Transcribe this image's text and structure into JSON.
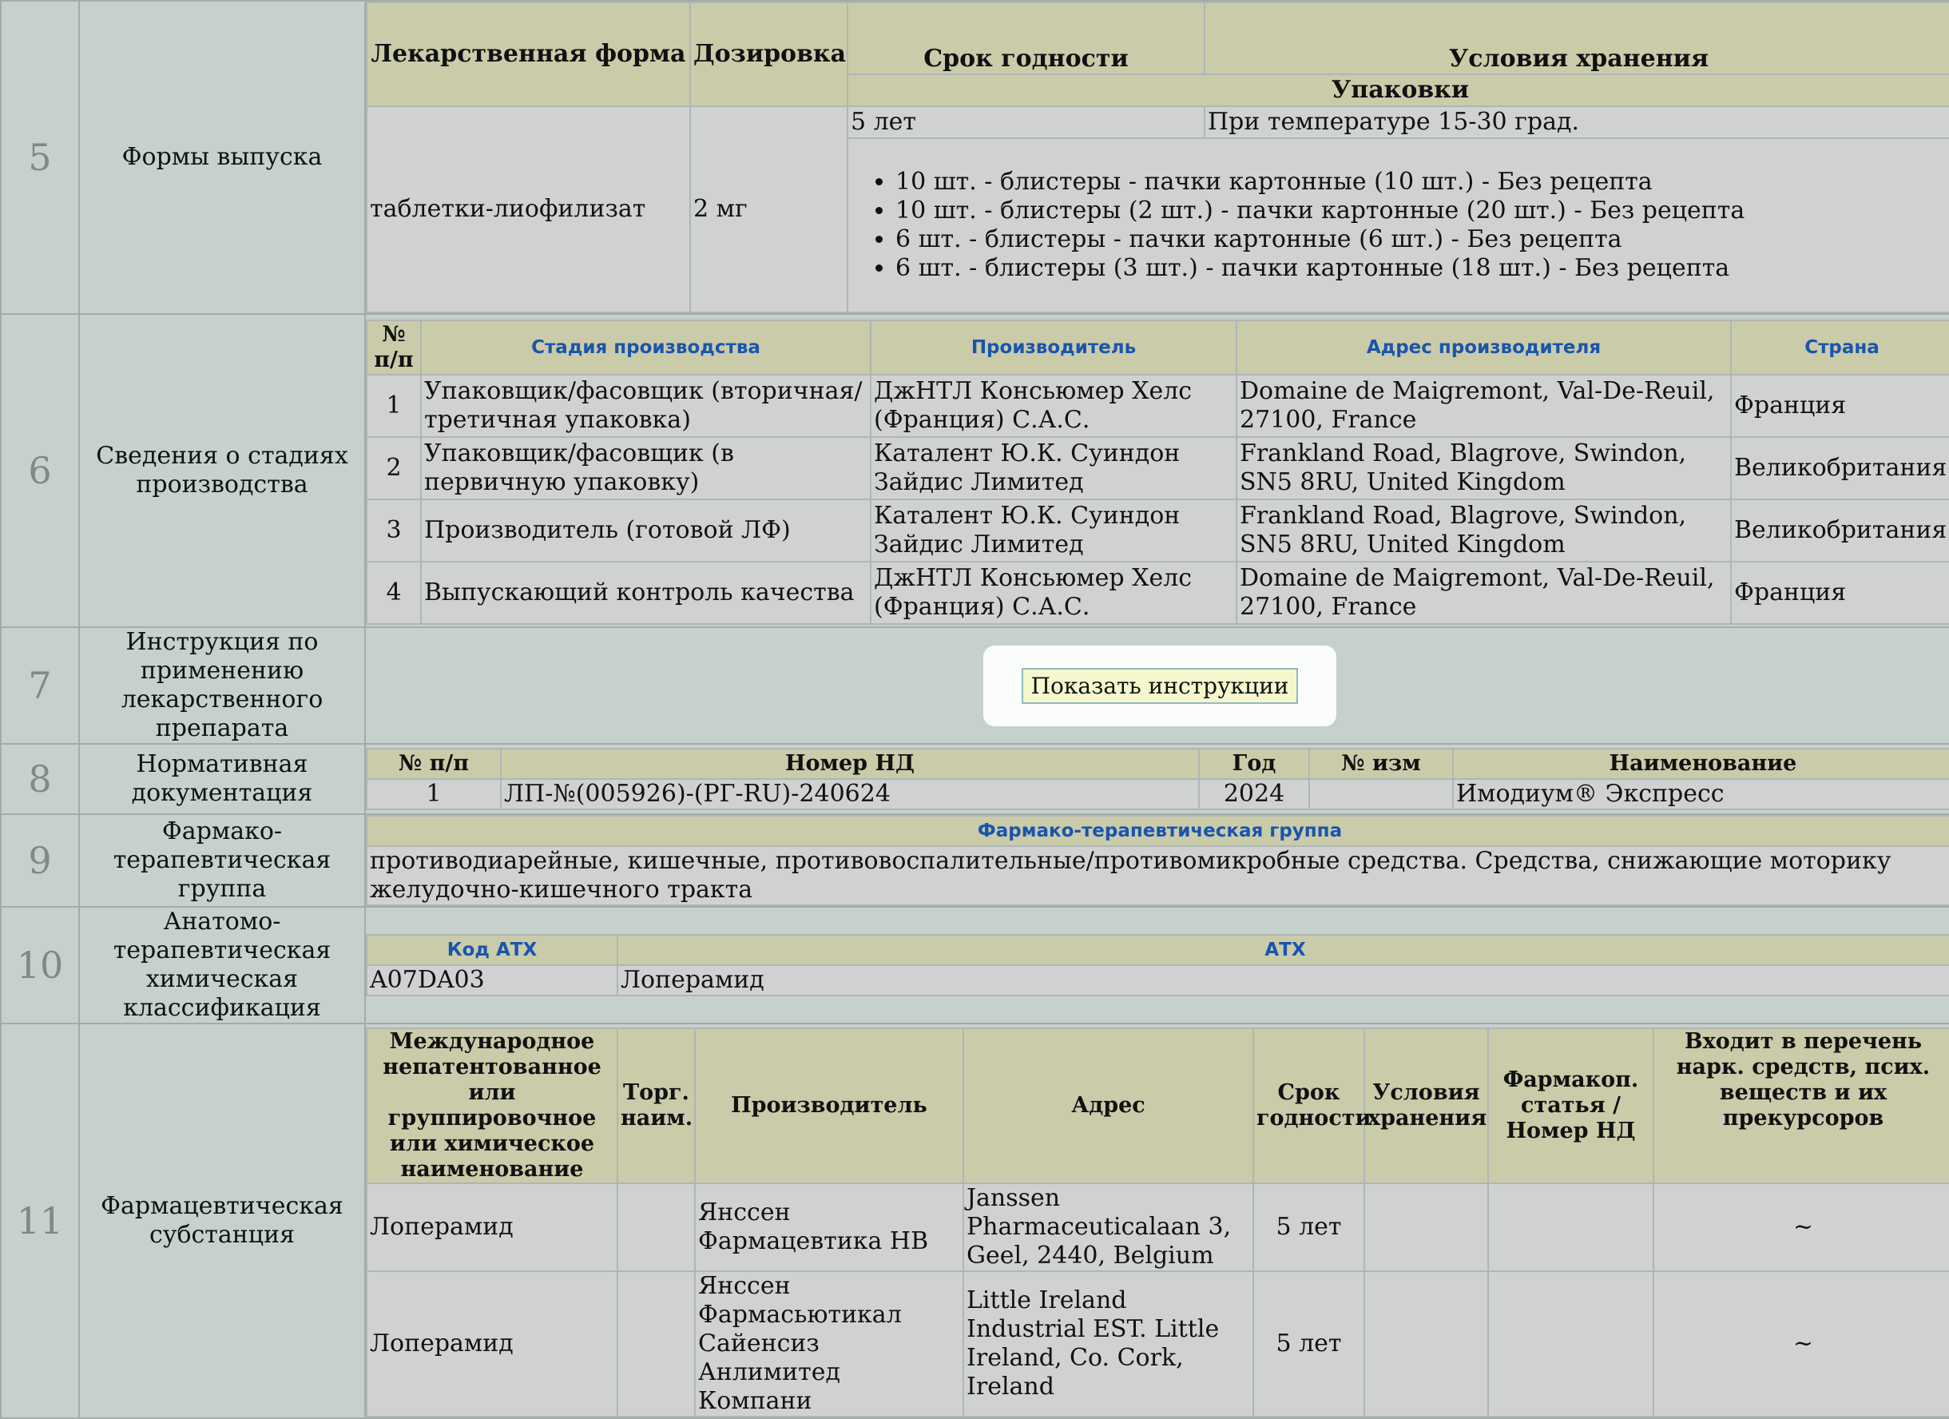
{
  "rows": {
    "r5": {
      "num": "5",
      "label": "Формы выпуска"
    },
    "r6": {
      "num": "6",
      "label": "Сведения о стадиях производства"
    },
    "r7": {
      "num": "7",
      "label": "Инструкция по применению лекарственного препарата"
    },
    "r8": {
      "num": "8",
      "label": "Нормативная документация"
    },
    "r9": {
      "num": "9",
      "label": "Фармако-терапевтическая группа"
    },
    "r10": {
      "num": "10",
      "label": "Анатомо-терапевтическая химическая классификация"
    },
    "r11": {
      "num": "11",
      "label": "Фармацевтическая субстанция"
    }
  },
  "forms": {
    "headers": {
      "form": "Лекарственная форма",
      "dosage": "Дозировка",
      "shelf": "Срок годности",
      "storage": "Условия хранения",
      "packages": "Упаковки"
    },
    "form": "таблетки-лиофилизат",
    "dosage": "2 мг",
    "shelf": "5 лет",
    "storage": "При температуре 15-30 град.",
    "packs": [
      "10 шт. - блистеры - пачки картонные (10 шт.) - Без рецепта",
      "10 шт. - блистеры (2 шт.) - пачки картонные (20 шт.) - Без рецепта",
      "6 шт. - блистеры - пачки картонные (6 шт.) - Без рецепта",
      "6 шт. - блистеры (3 шт.) - пачки картонные (18 шт.) - Без рецепта"
    ]
  },
  "stages": {
    "headers": {
      "num": "№ п/п",
      "stage": "Стадия производства",
      "maker": "Производитель",
      "address": "Адрес производителя",
      "country": "Страна"
    },
    "rows": [
      [
        "1",
        "Упаковщик/фасовщик (вторичная/третичная упаковка)",
        "ДжНТЛ Консьюмер Хелс (Франция) С.А.С.",
        "Domaine de Maigremont, Val-De-Reuil, 27100, France",
        "Франция"
      ],
      [
        "2",
        "Упаковщик/фасовщик (в первичную упаковку)",
        "Каталент Ю.К. Суиндон Зайдис Лимитед",
        "Frankland Road, Blagrove, Swindon, SN5 8RU, United Kingdom",
        "Великобритания"
      ],
      [
        "3",
        "Производитель (готовой ЛФ)",
        "Каталент Ю.К. Суиндон Зайдис Лимитед",
        "Frankland Road, Blagrove, Swindon, SN5 8RU, United Kingdom",
        "Великобритания"
      ],
      [
        "4",
        "Выпускающий контроль качества",
        "ДжНТЛ Консьюмер Хелс (Франция) С.А.С.",
        "Domaine de Maigremont, Val-De-Reuil, 27100, France",
        "Франция"
      ]
    ]
  },
  "instructions": {
    "button_label": "Показать инструкции"
  },
  "normdoc": {
    "headers": {
      "num": "№ п/п",
      "nd": "Номер НД",
      "year": "Год",
      "change": "№ изм",
      "name": "Наименование"
    },
    "rows": [
      [
        "1",
        "ЛП-№(005926)-(РГ-RU)-240624",
        "2024",
        "",
        "Имодиум® Экспресс"
      ]
    ]
  },
  "pharm_group": {
    "header": "Фармако-терапевтическая группа",
    "text": "противодиарейные, кишечные, противовоспалительные/противомикробные средства. Средства, снижающие моторику желудочно-кишечного тракта"
  },
  "atc": {
    "headers": {
      "code": "Код АТХ",
      "atc": "АТХ"
    },
    "code": "A07DA03",
    "name": "Лоперамид"
  },
  "substance": {
    "headers": {
      "inn": "Международное непатентованное или группировочное или химическое наименование",
      "trade": "Торг. наим.",
      "maker": "Производитель",
      "address": "Адрес",
      "shelf": "Срок годности",
      "storage": "Условия хранения",
      "pharmacop": "Фармакоп. статья / Номер НД",
      "narc": "Входит в перечень нарк. средств, псих. веществ и их прекурсоров"
    },
    "rows": [
      [
        "Лоперамид",
        "",
        "Янссен Фармацевтика НВ",
        "Janssen Pharmaceuticalaan 3, Geel, 2440, Belgium",
        "5 лет",
        "",
        "",
        "~"
      ],
      [
        "Лоперамид",
        "",
        "Янссен Фармасьютикал Сайенсиз Анлимитед Компани",
        "Little Ireland Industrial EST. Little Ireland, Co. Cork, Ireland",
        "5 лет",
        "",
        "",
        "~"
      ]
    ]
  }
}
